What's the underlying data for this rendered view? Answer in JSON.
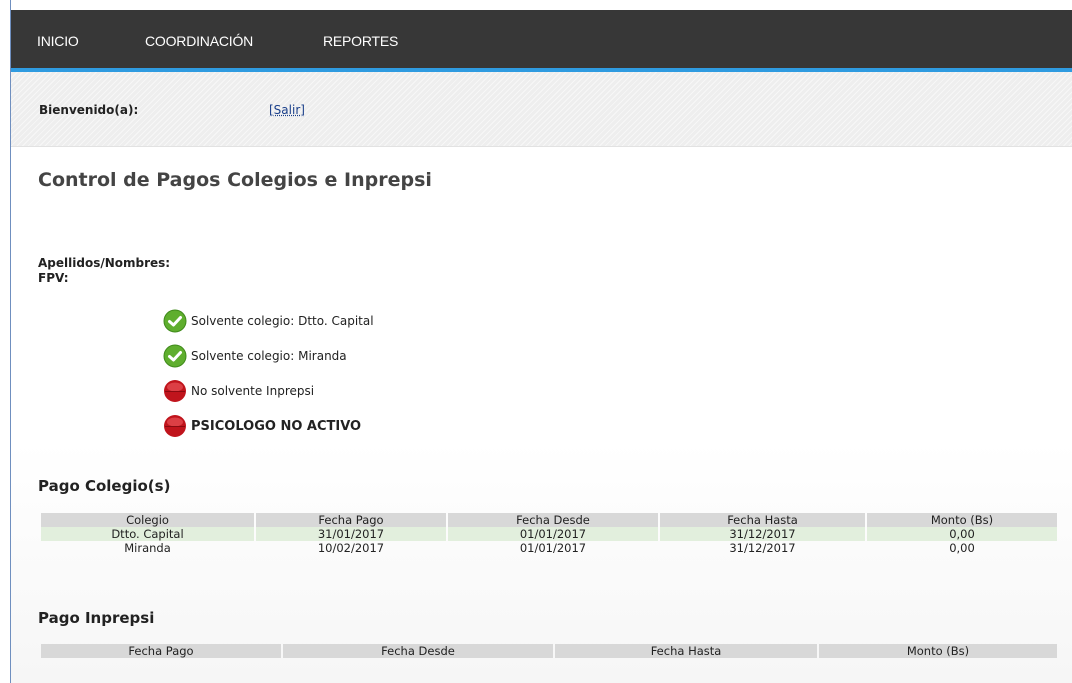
{
  "nav": {
    "items": [
      {
        "label": "INICIO"
      },
      {
        "label": "COORDINACIÓN"
      },
      {
        "label": "REPORTES"
      }
    ]
  },
  "header": {
    "welcome_label": "Bienvenido(a):",
    "logout_label": "[Salir]"
  },
  "page": {
    "title": "Control de Pagos Colegios e Inprepsi"
  },
  "person": {
    "name_label": "Apellidos/Nombres:",
    "fpv_label": "FPV:"
  },
  "status": [
    {
      "text": "Solvente colegio: Dtto. Capital",
      "icon": "green-check-icon",
      "color": "#5fae2e"
    },
    {
      "text": "Solvente colegio: Miranda",
      "icon": "green-check-icon",
      "color": "#5fae2e"
    },
    {
      "text": "No solvente Inprepsi",
      "icon": "red-dot-icon",
      "color": "#c0141c"
    },
    {
      "text": "PSICOLOGO NO ACTIVO",
      "icon": "red-dot-icon",
      "color": "#c0141c"
    }
  ],
  "colegio_section": {
    "title": "Pago Colegio(s)",
    "headers": [
      "Colegio",
      "Fecha Pago",
      "Fecha Desde",
      "Fecha Hasta",
      "Monto (Bs)"
    ],
    "rows": [
      [
        "Dtto. Capital",
        "31/01/2017",
        "01/01/2017",
        "31/12/2017",
        "0,00"
      ],
      [
        "Miranda",
        "10/02/2017",
        "01/01/2017",
        "31/12/2017",
        "0,00"
      ]
    ]
  },
  "inprepsi_section": {
    "title": "Pago Inprepsi",
    "headers": [
      "Fecha Pago",
      "Fecha Desde",
      "Fecha Hasta",
      "Monto (Bs)"
    ]
  },
  "colors": {
    "navbar": "#373737",
    "accent": "#2f9be0",
    "row_highlight": "#e2efdd",
    "table_header": "#d8d8d8"
  }
}
